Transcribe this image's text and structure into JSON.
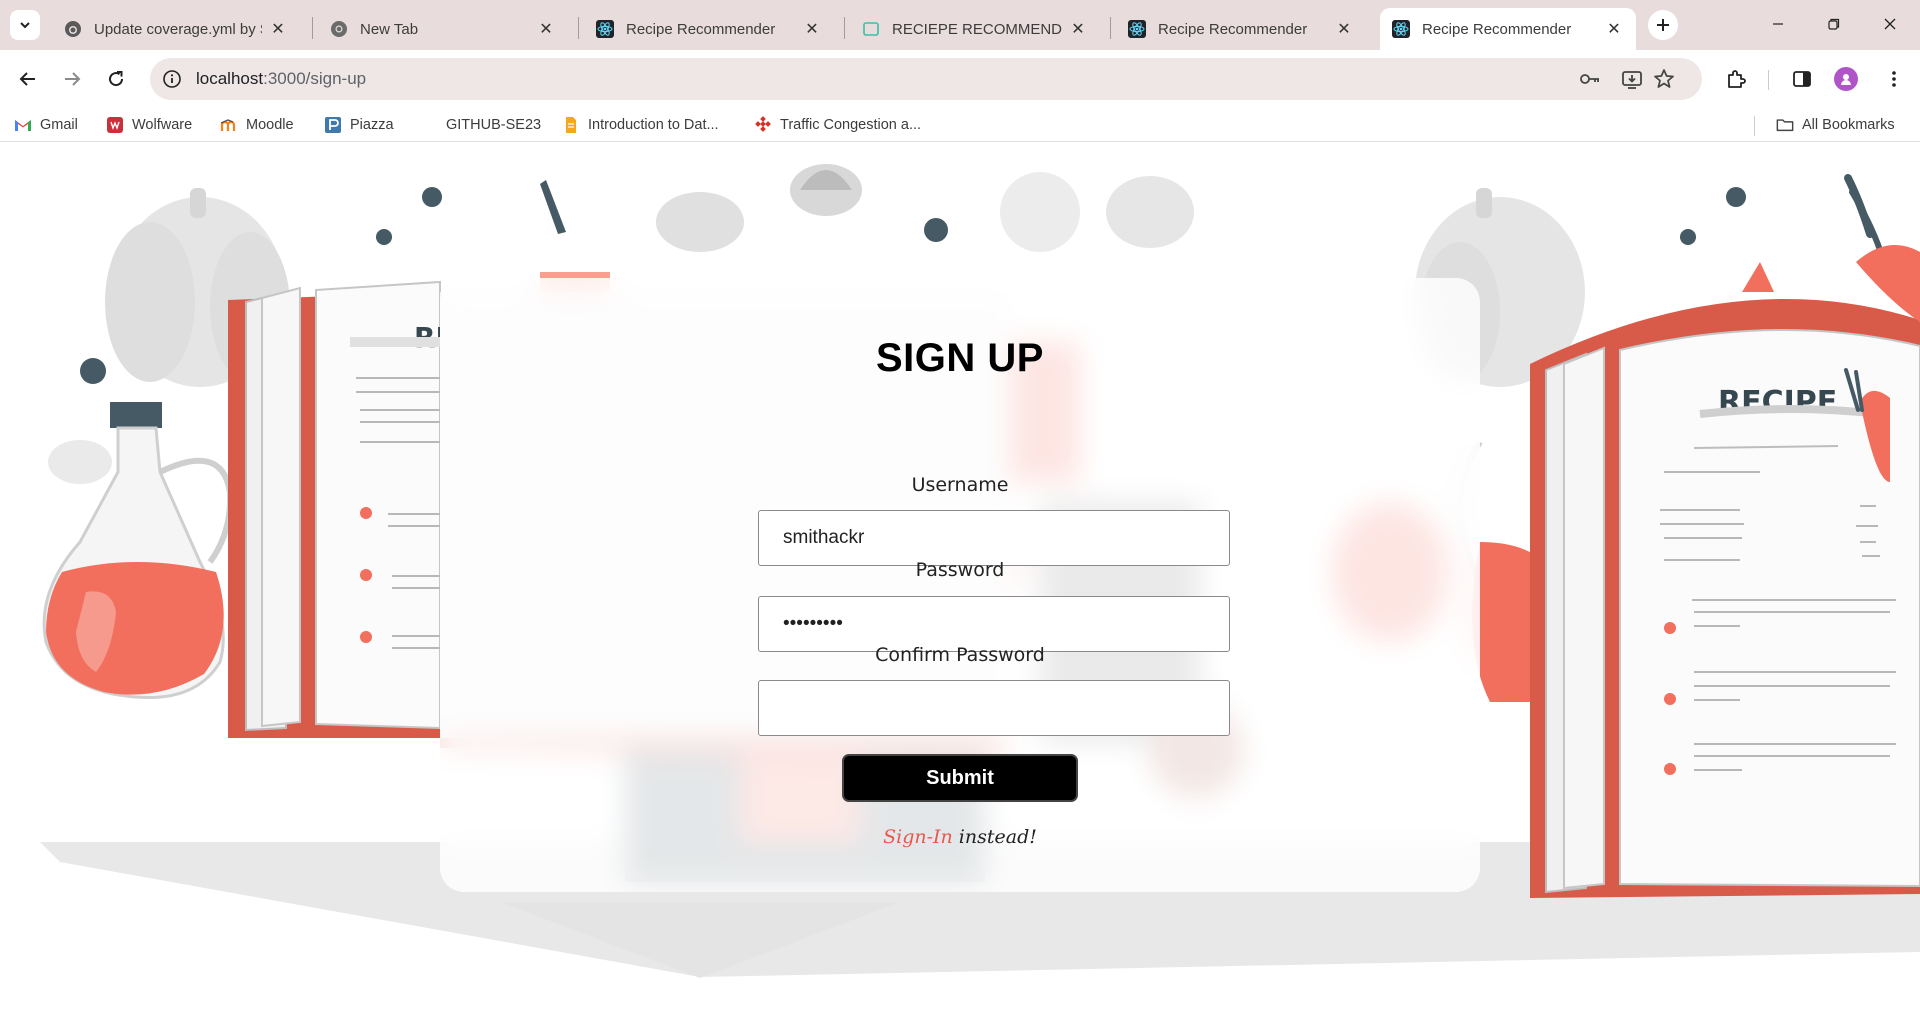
{
  "browser": {
    "tabs": [
      {
        "title": "Update coverage.yml by Sr",
        "icon": "github-icon",
        "active": false
      },
      {
        "title": "New Tab",
        "icon": "chrome-icon",
        "active": false
      },
      {
        "title": "Recipe Recommender",
        "icon": "react-icon",
        "active": false
      },
      {
        "title": "RECIEPE RECOMMENDER E",
        "icon": "doc-icon",
        "active": false
      },
      {
        "title": "Recipe Recommender",
        "icon": "react-icon",
        "active": false
      },
      {
        "title": "Recipe Recommender",
        "icon": "react-icon",
        "active": true
      }
    ],
    "url": {
      "host": "localhost",
      "path": ":3000/sign-up"
    },
    "bookmarks": [
      {
        "label": "Gmail",
        "icon": "gmail-icon"
      },
      {
        "label": "Wolfware",
        "icon": "wolfware-icon"
      },
      {
        "label": "Moodle",
        "icon": "moodle-icon"
      },
      {
        "label": "Piazza",
        "icon": "piazza-icon"
      },
      {
        "label": "GITHUB-SE23",
        "icon": "none"
      },
      {
        "label": "Introduction to Dat...",
        "icon": "bookmark-doc-icon"
      },
      {
        "label": "Traffic Congestion a...",
        "icon": "traffic-icon"
      }
    ],
    "all_bookmarks": "All Bookmarks"
  },
  "form": {
    "title": "SIGN UP",
    "username_label": "Username",
    "username_value": "smithackr",
    "password_label": "Password",
    "password_value": "smithackr",
    "confirm_label": "Confirm Password",
    "confirm_value": "",
    "submit_label": "Submit",
    "signin_link": "Sign-In",
    "signin_suffix": " instead!"
  },
  "colors": {
    "accent": "#e8584c",
    "tabstrip": "#e8dcdc",
    "illustration_red": "#f26f5e",
    "illustration_dark": "#455a64"
  },
  "illustration": {
    "left_book_heading": "RE",
    "right_book_heading": "RECIPE"
  }
}
